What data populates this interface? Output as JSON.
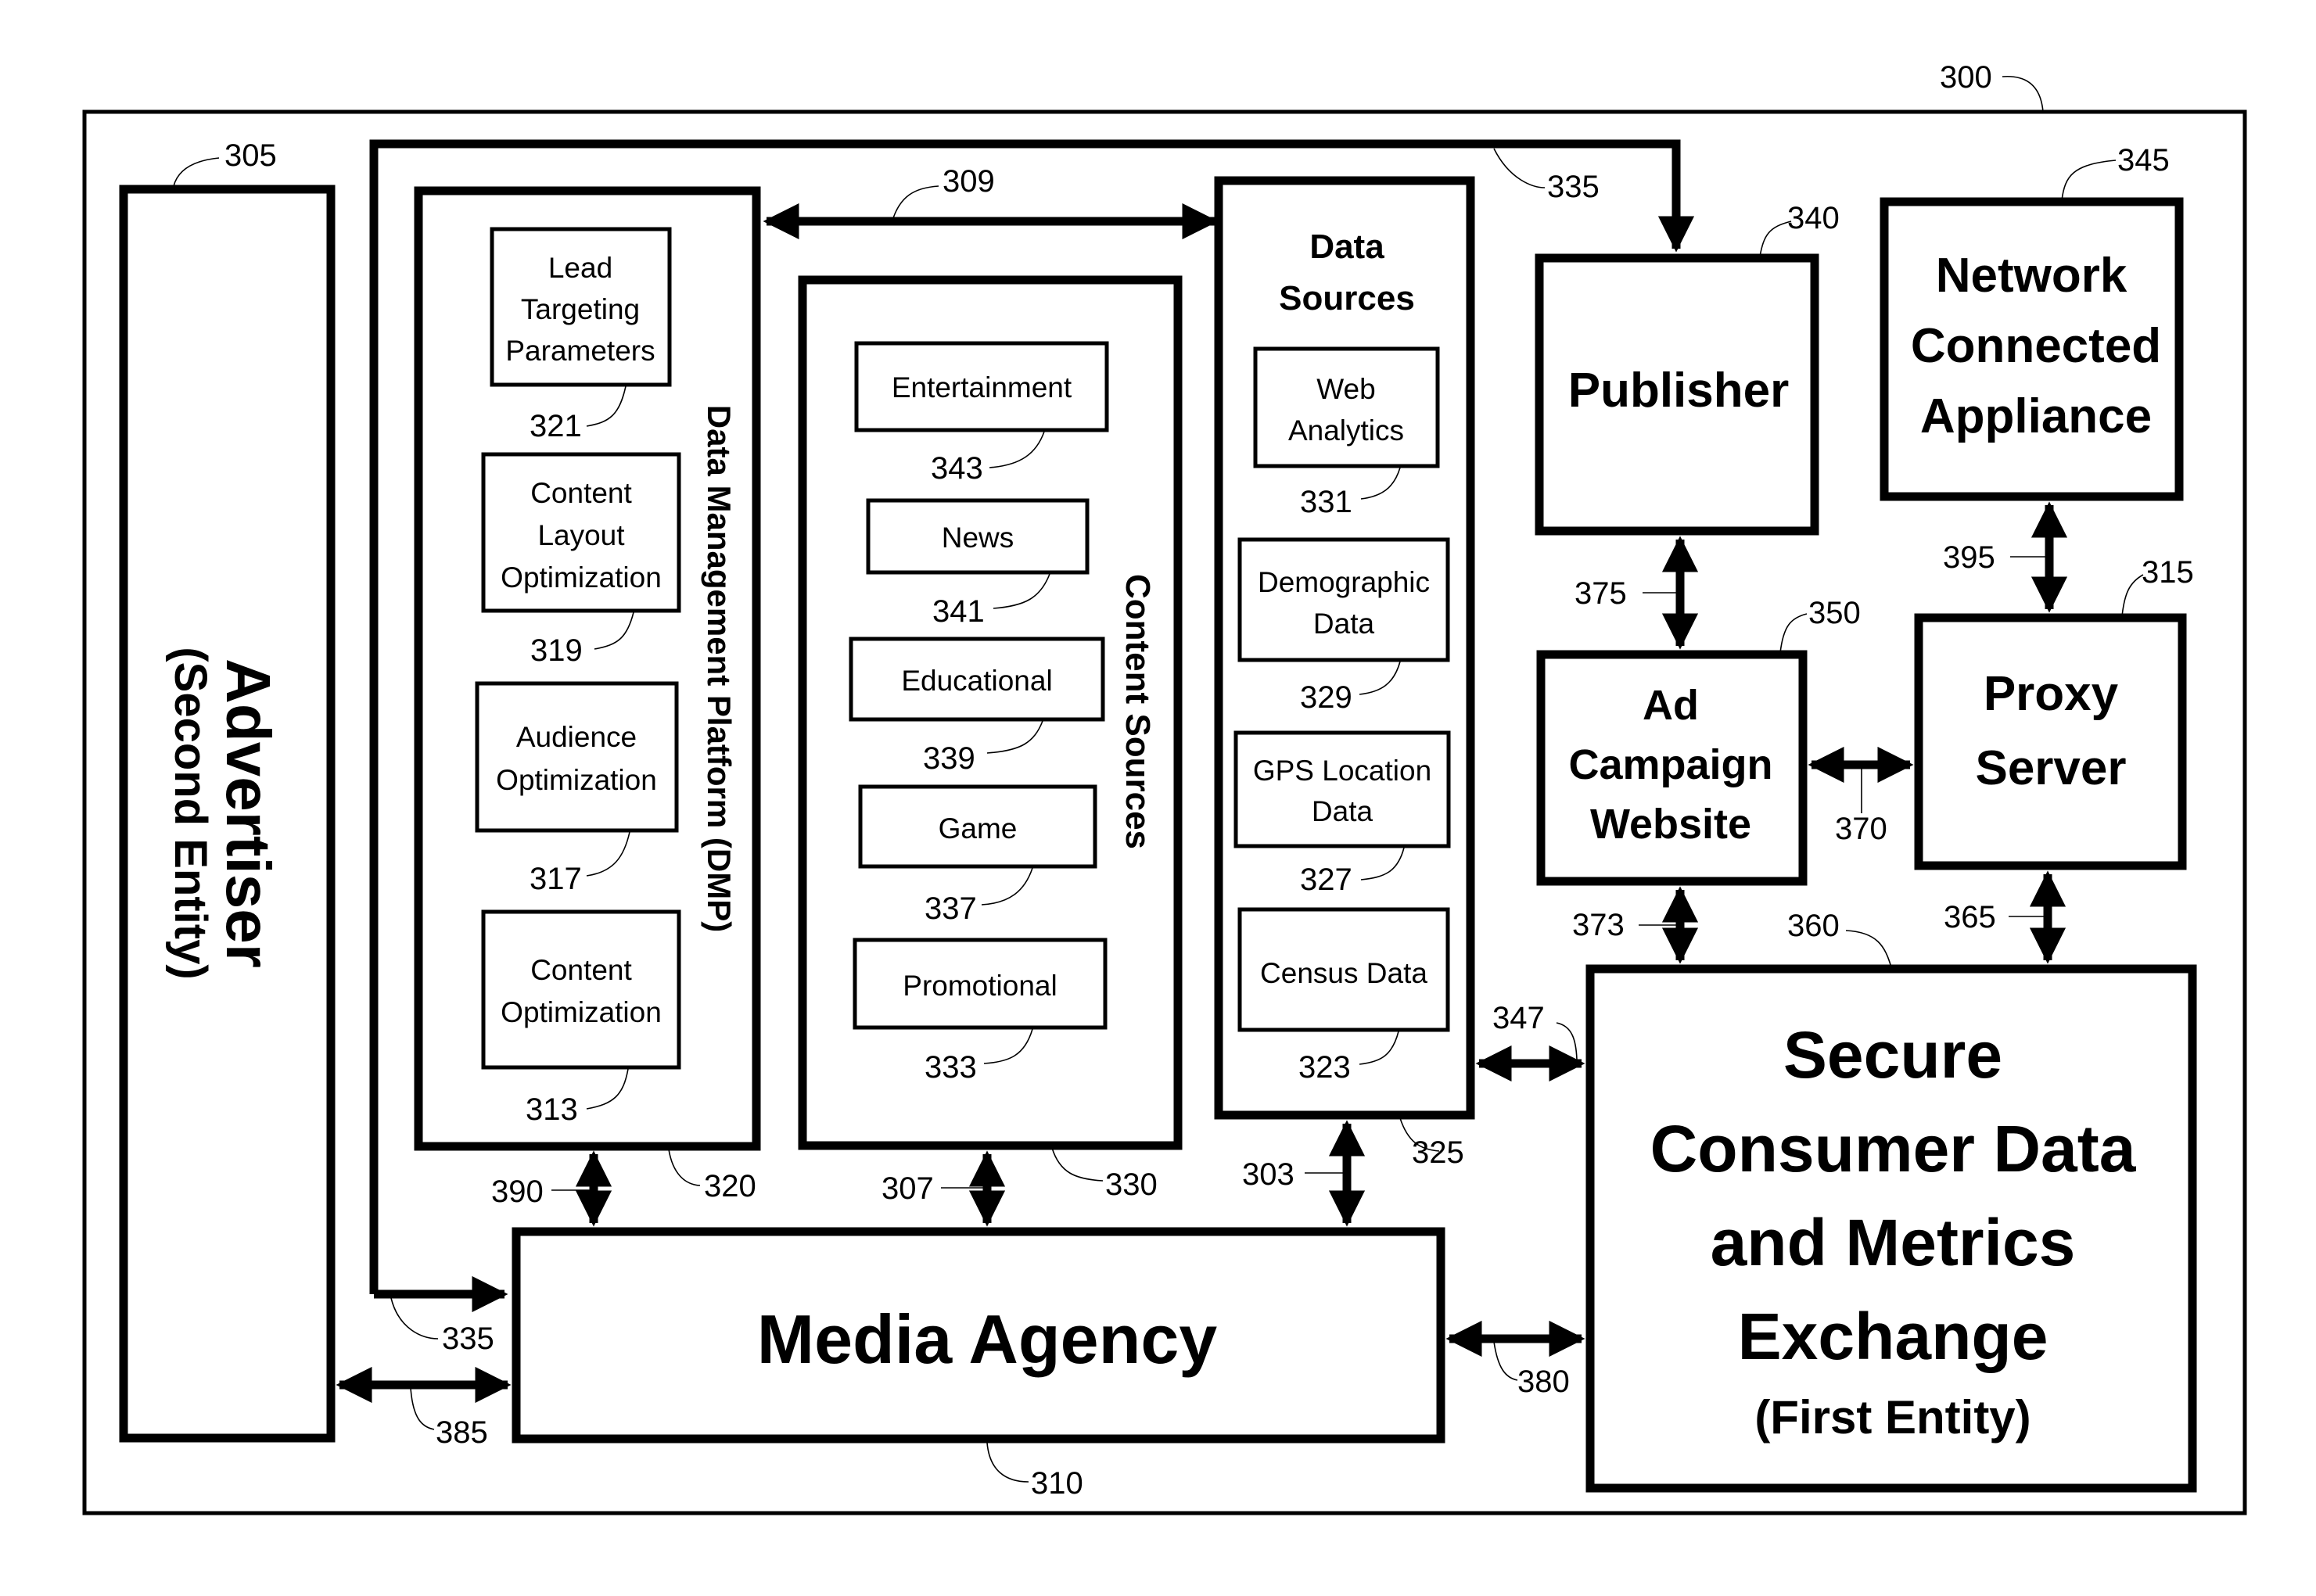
{
  "figure": {
    "ref": "300",
    "nodes": {
      "advertiser": {
        "ref": "305",
        "title": "Advertiser",
        "subtitle": "(Second Entity)"
      },
      "dmp": {
        "ref": "320",
        "title": "Data Management Platform (DMP)",
        "items": [
          {
            "ref": "321",
            "lines": [
              "Lead",
              "Targeting",
              "Parameters"
            ]
          },
          {
            "ref": "319",
            "lines": [
              "Content",
              "Layout",
              "Optimization"
            ]
          },
          {
            "ref": "317",
            "lines": [
              "Audience",
              "Optimization"
            ]
          },
          {
            "ref": "313",
            "lines": [
              "Content",
              "Optimization"
            ]
          }
        ]
      },
      "content_sources": {
        "ref": "330",
        "title": "Content Sources",
        "items": [
          {
            "ref": "343",
            "label": "Entertainment"
          },
          {
            "ref": "341",
            "label": "News"
          },
          {
            "ref": "339",
            "label": "Educational"
          },
          {
            "ref": "337",
            "label": "Game"
          },
          {
            "ref": "333",
            "label": "Promotional"
          }
        ]
      },
      "data_sources": {
        "ref": "325",
        "title_lines": [
          "Data",
          "Sources"
        ],
        "items": [
          {
            "ref": "331",
            "lines": [
              "Web",
              "Analytics"
            ]
          },
          {
            "ref": "329",
            "lines": [
              "Demographic",
              "Data"
            ]
          },
          {
            "ref": "327",
            "lines": [
              "GPS Location",
              "Data"
            ]
          },
          {
            "ref": "323",
            "lines": [
              "Census Data"
            ]
          }
        ]
      },
      "publisher": {
        "ref": "340",
        "title": "Publisher"
      },
      "appliance": {
        "ref": "345",
        "lines": [
          "Network",
          "Connected",
          "Appliance"
        ]
      },
      "ad_campaign": {
        "ref": "350",
        "lines": [
          "Ad",
          "Campaign",
          "Website"
        ]
      },
      "proxy": {
        "ref": "315",
        "lines": [
          "Proxy",
          "Server"
        ]
      },
      "exchange": {
        "ref": "360",
        "lines": [
          "Secure",
          "Consumer Data",
          "and Metrics",
          "Exchange"
        ],
        "subtitle": "(First Entity)"
      },
      "media_agency": {
        "ref": "310",
        "title": "Media Agency"
      }
    },
    "connections": {
      "dmp_data_sources": "309",
      "top_bus_publisher": "335",
      "bus_media_agency": "335",
      "publisher_ad_campaign": "375",
      "appliance_proxy": "395",
      "ad_campaign_proxy": "370",
      "ad_campaign_exchange": "373",
      "proxy_exchange": "365",
      "data_sources_exchange": "347",
      "media_agency_exchange": "380",
      "advertiser_media_agency": "385",
      "dmp_media_agency": "390",
      "content_media_agency": "307",
      "data_sources_media_agency": "303"
    }
  }
}
